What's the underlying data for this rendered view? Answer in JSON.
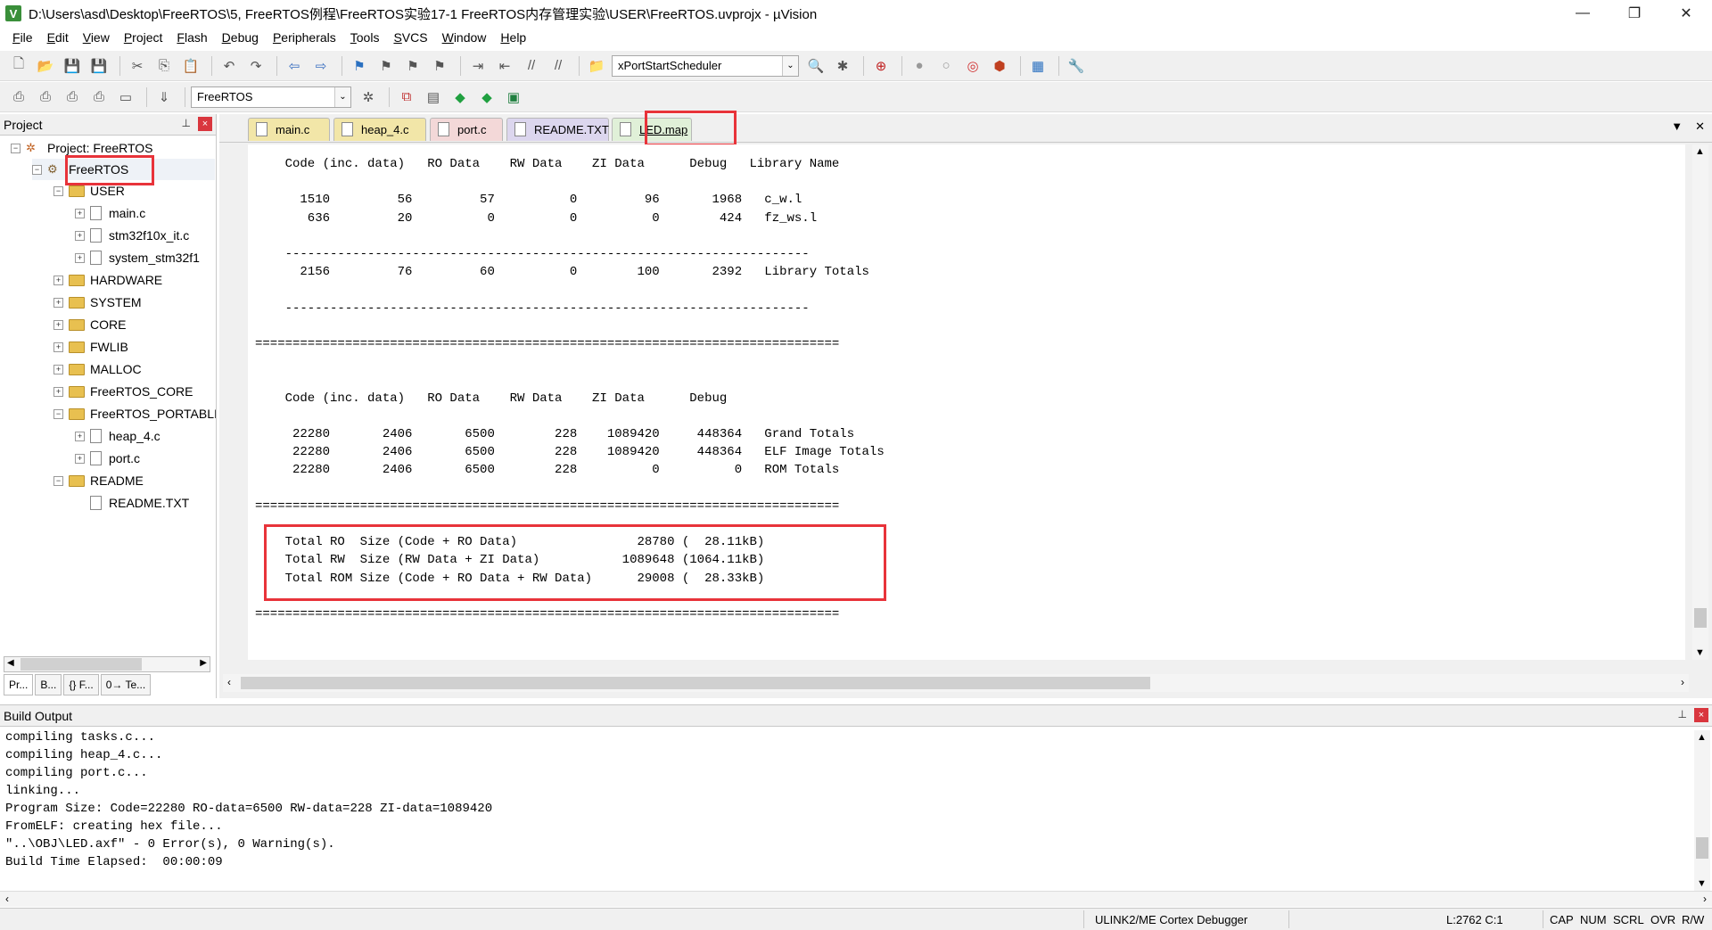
{
  "window": {
    "title": "D:\\Users\\asd\\Desktop\\FreeRTOS\\5, FreeRTOS例程\\FreeRTOS实验17-1 FreeRTOS内存管理实验\\USER\\FreeRTOS.uvprojx - µVision",
    "app_icon": "V",
    "minimize": "—",
    "restore": "❐",
    "close": "✕"
  },
  "menu": [
    {
      "accel": "F",
      "rest": "ile"
    },
    {
      "accel": "E",
      "rest": "dit"
    },
    {
      "accel": "V",
      "rest": "iew"
    },
    {
      "accel": "P",
      "rest": "roject"
    },
    {
      "accel": "F",
      "rest": "lash"
    },
    {
      "accel": "D",
      "rest": "ebug"
    },
    {
      "accel": "P",
      "rest": "eripherals"
    },
    {
      "accel": "T",
      "rest": "ools"
    },
    {
      "accel": "S",
      "rest": "VCS"
    },
    {
      "accel": "W",
      "rest": "indow"
    },
    {
      "accel": "H",
      "rest": "elp"
    }
  ],
  "toolbar": {
    "find_combo_value": "xPortStartScheduler",
    "target_combo_value": "FreeRTOS"
  },
  "project_panel": {
    "title": "Project",
    "pin": "⊥",
    "close": "×",
    "root_label": "Project: FreeRTOS",
    "target_label": "FreeRTOS",
    "tree": [
      {
        "label": "USER",
        "type": "folder",
        "level": 2,
        "expanded": true
      },
      {
        "label": "main.c",
        "type": "file",
        "level": 3
      },
      {
        "label": "stm32f10x_it.c",
        "type": "file",
        "level": 3
      },
      {
        "label": "system_stm32f1",
        "type": "file",
        "level": 3
      },
      {
        "label": "HARDWARE",
        "type": "folder",
        "level": 2,
        "expanded": false
      },
      {
        "label": "SYSTEM",
        "type": "folder",
        "level": 2,
        "expanded": false
      },
      {
        "label": "CORE",
        "type": "folder",
        "level": 2,
        "expanded": false
      },
      {
        "label": "FWLIB",
        "type": "folder",
        "level": 2,
        "expanded": false
      },
      {
        "label": "MALLOC",
        "type": "folder",
        "level": 2,
        "expanded": false
      },
      {
        "label": "FreeRTOS_CORE",
        "type": "folder",
        "level": 2,
        "expanded": false
      },
      {
        "label": "FreeRTOS_PORTABLI",
        "type": "folder",
        "level": 2,
        "expanded": true
      },
      {
        "label": "heap_4.c",
        "type": "file",
        "level": 3
      },
      {
        "label": "port.c",
        "type": "file",
        "level": 3
      },
      {
        "label": "README",
        "type": "folder",
        "level": 2,
        "expanded": true
      },
      {
        "label": "README.TXT",
        "type": "file",
        "level": 3
      }
    ],
    "bottom_tabs": [
      "Pr...",
      "B...",
      "{} F...",
      "0→ Te..."
    ]
  },
  "editor": {
    "tabs": [
      {
        "label": "main.c",
        "bg": "#f2e6a8"
      },
      {
        "label": "heap_4.c",
        "bg": "#f2e6a8"
      },
      {
        "label": "port.c",
        "bg": "#f3d8d8"
      },
      {
        "label": "README.TXT",
        "bg": "#dcd6ee"
      },
      {
        "label": "LED.map",
        "bg": "#e0f0d8"
      }
    ],
    "active_tab": "LED.map",
    "lines": [
      "    Code (inc. data)   RO Data    RW Data    ZI Data      Debug   Library Name",
      "",
      "      1510         56         57          0         96       1968   c_w.l",
      "       636         20          0          0          0        424   fz_ws.l",
      "",
      "    ----------------------------------------------------------------------",
      "      2156         76         60          0        100       2392   Library Totals",
      "",
      "    ----------------------------------------------------------------------",
      "",
      "==============================================================================",
      "",
      "",
      "    Code (inc. data)   RO Data    RW Data    ZI Data      Debug",
      "",
      "     22280       2406       6500        228    1089420     448364   Grand Totals",
      "     22280       2406       6500        228    1089420     448364   ELF Image Totals",
      "     22280       2406       6500        228          0          0   ROM Totals",
      "",
      "==============================================================================",
      "",
      "    Total RO  Size (Code + RO Data)                28780 (  28.11kB)",
      "    Total RW  Size (RW Data + ZI Data)           1089648 (1064.11kB)",
      "    Total ROM Size (Code + RO Data + RW Data)      29008 (  28.33kB)",
      "",
      "==============================================================================",
      ""
    ],
    "dropdown_arrow": "▼",
    "close": "✕"
  },
  "build_output": {
    "title": "Build Output",
    "pin": "⊥",
    "close": "×",
    "lines": [
      "compiling tasks.c...",
      "compiling heap_4.c...",
      "compiling port.c...",
      "linking...",
      "Program Size: Code=22280 RO-data=6500 RW-data=228 ZI-data=1089420",
      "FromELF: creating hex file...",
      "\"..\\OBJ\\LED.axf\" - 0 Error(s), 0 Warning(s).",
      "Build Time Elapsed:  00:00:09"
    ]
  },
  "status": {
    "debugger": "ULINK2/ME Cortex Debugger",
    "position": "L:2762 C:1",
    "cap": "CAP",
    "num": "NUM",
    "scrl": "SCRL",
    "ovr": "OVR",
    "rw": "R/W"
  },
  "colors": {
    "highlight": "#e8333a",
    "current_line": "#e6fae6"
  }
}
